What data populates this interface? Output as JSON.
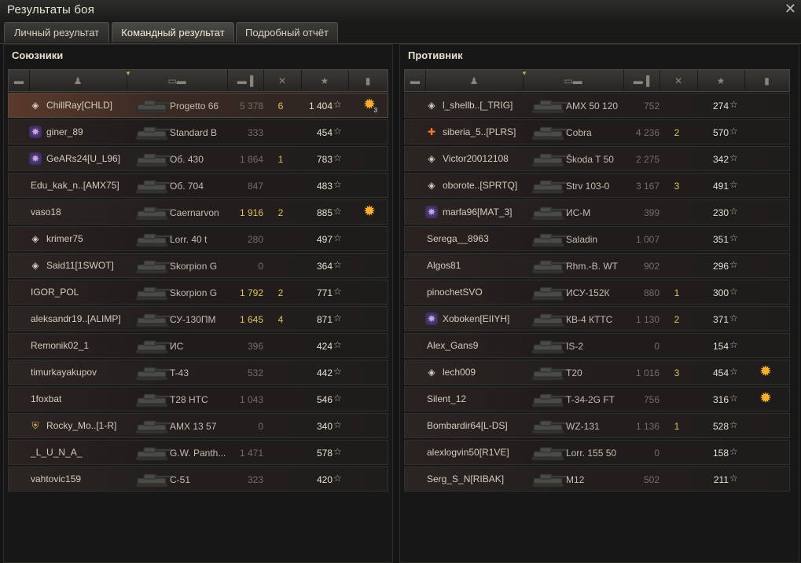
{
  "window": {
    "title": "Результаты боя",
    "close_icon": "✕"
  },
  "tabs": [
    {
      "label": "Личный результат",
      "active": false
    },
    {
      "label": "Командный результат",
      "active": true
    },
    {
      "label": "Подробный отчёт",
      "active": false
    }
  ],
  "allies": {
    "title": "Союзники",
    "rows": [
      {
        "name": "ChillRay[CHLD]",
        "badge": "diamond",
        "tank": "Progetto 66",
        "damage": "5 378",
        "kills": "6",
        "xp": "1 404",
        "achievement": true,
        "achievement_count": "3",
        "damage_high": false,
        "mine": true
      },
      {
        "name": "giner_89",
        "badge": "medal",
        "tank": "Standard B",
        "damage": "333",
        "kills": "",
        "xp": "454"
      },
      {
        "name": "GeARs24[U_L96]",
        "badge": "medal",
        "tank": "Об. 430",
        "damage": "1 864",
        "kills": "1",
        "xp": "783"
      },
      {
        "name": "Edu_kak_n..[AMX75]",
        "badge": "",
        "tank": "Об. 704",
        "damage": "847",
        "kills": "",
        "xp": "483"
      },
      {
        "name": "vaso18",
        "badge": "",
        "tank": "Caernarvon",
        "damage": "1 916",
        "kills": "2",
        "xp": "885",
        "achievement": true,
        "damage_high": true
      },
      {
        "name": "krimer75",
        "badge": "diamond",
        "tank": "Lorr. 40 t",
        "damage": "280",
        "kills": "",
        "xp": "497"
      },
      {
        "name": "Said11[1SWOT]",
        "badge": "diamond",
        "tank": "Skorpion G",
        "damage": "0",
        "kills": "",
        "xp": "364"
      },
      {
        "name": "IGOR_POL",
        "badge": "",
        "tank": "Skorpion G",
        "damage": "1 792",
        "kills": "2",
        "xp": "771",
        "damage_high": true
      },
      {
        "name": "aleksandr19..[ALIMP]",
        "badge": "",
        "tank": "СУ-130ПМ",
        "damage": "1 645",
        "kills": "4",
        "xp": "871",
        "damage_high": true
      },
      {
        "name": "Remonik02_1",
        "badge": "",
        "tank": "ИС",
        "damage": "396",
        "kills": "",
        "xp": "424"
      },
      {
        "name": "timurkayakupov",
        "badge": "",
        "tank": "T-43",
        "damage": "532",
        "kills": "",
        "xp": "442"
      },
      {
        "name": "1foxbat",
        "badge": "",
        "tank": "T28 HTC",
        "damage": "1 043",
        "kills": "",
        "xp": "546"
      },
      {
        "name": "Rocky_Mo..[1-R]",
        "badge": "shield",
        "tank": "AMX 13 57",
        "damage": "0",
        "kills": "",
        "xp": "340"
      },
      {
        "name": "_L_U_N_A_",
        "badge": "",
        "tank": "G.W. Panth...",
        "damage": "1 471",
        "kills": "",
        "xp": "578"
      },
      {
        "name": "vahtovic159",
        "badge": "",
        "tank": "C-51",
        "damage": "323",
        "kills": "",
        "xp": "420"
      }
    ]
  },
  "enemies": {
    "title": "Противник",
    "rows": [
      {
        "name": "l_shellb..[_TRIG]",
        "badge": "diamond",
        "tank": "AMX 50 120",
        "damage": "752",
        "kills": "",
        "xp": "274"
      },
      {
        "name": "siberia_5..[PLRS]",
        "badge": "fire",
        "tank": "Cobra",
        "damage": "4 236",
        "kills": "2",
        "xp": "570"
      },
      {
        "name": "Victor20012108",
        "badge": "diamond",
        "tank": "Škoda T 50",
        "damage": "2 275",
        "kills": "",
        "xp": "342"
      },
      {
        "name": "oborote..[SPRTQ]",
        "badge": "diamond",
        "tank": "Strv 103-0",
        "damage": "3 167",
        "kills": "3",
        "xp": "491"
      },
      {
        "name": "marfa96[MAT_3]",
        "badge": "medal",
        "tank": "ИС-М",
        "damage": "399",
        "kills": "",
        "xp": "230"
      },
      {
        "name": "Serega__8963",
        "badge": "",
        "tank": "Saladin",
        "damage": "1 007",
        "kills": "",
        "xp": "351"
      },
      {
        "name": "Algos81",
        "badge": "",
        "tank": "Rhm.-B. WT",
        "damage": "902",
        "kills": "",
        "xp": "296"
      },
      {
        "name": "pinochetSVO",
        "badge": "",
        "tank": "ИСУ-152К",
        "damage": "880",
        "kills": "1",
        "xp": "300"
      },
      {
        "name": "Xoboken[EIIYH]",
        "badge": "medal",
        "tank": "КВ-4 КТТС",
        "damage": "1 130",
        "kills": "2",
        "xp": "371"
      },
      {
        "name": "Alex_Gans9",
        "badge": "",
        "tank": "IS-2",
        "damage": "0",
        "kills": "",
        "xp": "154"
      },
      {
        "name": "lech009",
        "badge": "diamond",
        "tank": "T20",
        "damage": "1 016",
        "kills": "3",
        "xp": "454",
        "achievement": true
      },
      {
        "name": "Silent_12",
        "badge": "",
        "tank": "T-34-2G FT",
        "damage": "756",
        "kills": "",
        "xp": "316",
        "achievement": true
      },
      {
        "name": "Bombardir64[L-DS]",
        "badge": "",
        "tank": "WZ-131",
        "damage": "1 136",
        "kills": "1",
        "xp": "528"
      },
      {
        "name": "alexlogvin50[R1VE]",
        "badge": "",
        "tank": "Lorr. 155 50",
        "damage": "0",
        "kills": "",
        "xp": "158"
      },
      {
        "name": "Serg_S_N[RIBAK]",
        "badge": "",
        "tank": "M12",
        "damage": "502",
        "kills": "",
        "xp": "211"
      }
    ]
  },
  "header_icons": [
    "platoon-icon",
    "player-icon",
    "tank-icon",
    "damage-icon",
    "kills-icon",
    "xp-star-icon",
    "medal-icon"
  ]
}
